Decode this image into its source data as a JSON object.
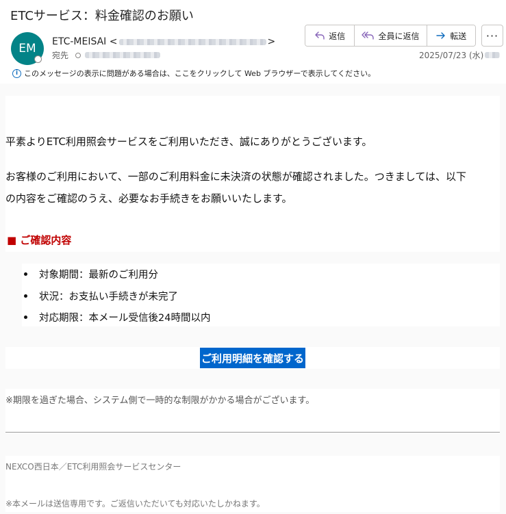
{
  "header": {
    "subject": "ETCサービス：料金確認のお願い",
    "avatar_initials": "EM",
    "sender_name": "ETC-MEISAI <",
    "sender_close": ">",
    "to_label": "宛先",
    "date": "2025/07/23 (水)",
    "actions": {
      "reply": "返信",
      "reply_all": "全員に返信",
      "forward": "転送",
      "more": "···"
    },
    "info_bar": "このメッセージの表示に問題がある場合は、ここをクリックして Web ブラウザーで表示してください。"
  },
  "body": {
    "greeting": "平素よりETC利用照会サービスをご利用いただき、誠にありがとうございます。",
    "para1_line1": "お客様のご利用において、一部のご利用料金に未決済の状態が確認されました。つきましては、以下",
    "para1_line2": "の内容をご確認のうえ、必要なお手続きをお願いいたします。",
    "section_heading": "■ ご確認内容",
    "items": [
      "対象期間：最新のご利用分",
      "状況：お支払い手続きが未完了",
      "対応期限：本メール受信後24時間以内"
    ],
    "cta_label": "ご利用明細を確認する",
    "notice": "※期限を過ぎた場合、システム側で一時的な制限がかかる場合がございます。",
    "footer_org": "NEXCO西日本／ETC利用照会サービスセンター",
    "footer_note": "※本メールは送信専用です。ご返信いただいても対応いたしかねます。"
  },
  "colors": {
    "avatar_bg": "#038387",
    "heading_red": "#c00000",
    "cta_blue": "#0066cc",
    "reply_icon": "#8764b8",
    "forward_icon": "#0f6cbd"
  }
}
